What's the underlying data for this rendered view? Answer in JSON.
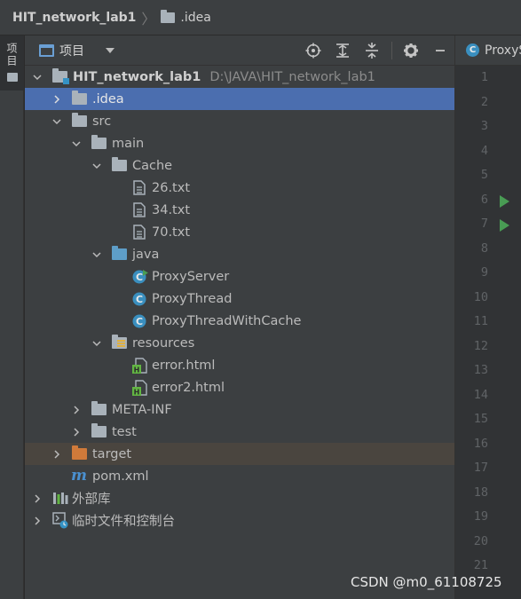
{
  "breadcrumb": {
    "project": "HIT_network_lab1",
    "folder": ".idea"
  },
  "left_stripe": {
    "project_tab_label": "项目"
  },
  "panel": {
    "title": "项目",
    "tools": [
      "locate-icon",
      "expand-all-icon",
      "collapse-all-icon",
      "gear-icon"
    ]
  },
  "tree": {
    "root_label": "HIT_network_lab1",
    "root_path": "D:\\JAVA\\HIT_network_lab1",
    "idea": ".idea",
    "src": "src",
    "main": "main",
    "cache": "Cache",
    "cache_files": [
      "26.txt",
      "34.txt",
      "70.txt"
    ],
    "java": "java",
    "java_classes": [
      "ProxyServer",
      "ProxyThread",
      "ProxyThreadWithCache"
    ],
    "resources": "resources",
    "resource_files": [
      "error.html",
      "error2.html"
    ],
    "meta_inf": "META-INF",
    "test": "test",
    "target": "target",
    "pom": "pom.xml",
    "external_libs": "外部库",
    "scratches": "临时文件和控制台"
  },
  "editor": {
    "tab_label": "ProxyServer",
    "line_numbers": [
      "1",
      "2",
      "3",
      "4",
      "5",
      "6",
      "7",
      "8",
      "9",
      "10",
      "11",
      "12",
      "13",
      "14",
      "15",
      "16",
      "17",
      "18",
      "19",
      "20",
      "21"
    ],
    "run_gutter_lines": [
      "6",
      "7"
    ]
  },
  "watermark": "CSDN @m0_61108725",
  "colors": {
    "selection": "#4b6eaf",
    "excluded_row": "#4a453f",
    "folder_gray": "#a9b2ba",
    "source_folder_blue": "#5e9ec8",
    "excluded_folder_orange": "#d07a3a",
    "class_icon_blue": "#3a8fbf",
    "run_green": "#499c54"
  }
}
